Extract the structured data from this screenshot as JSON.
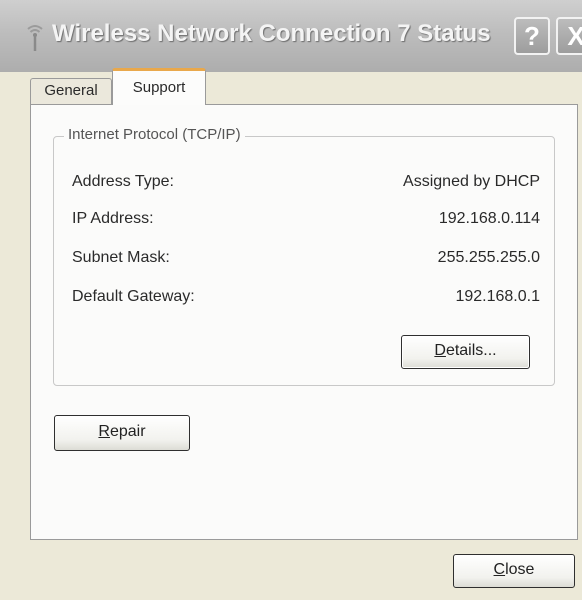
{
  "window": {
    "title": "Wireless Network Connection 7 Status",
    "help_label": "?",
    "close_label": "X"
  },
  "tabs": [
    {
      "label": "General",
      "selected": false
    },
    {
      "label": "Support",
      "selected": true
    }
  ],
  "group": {
    "legend": "Internet Protocol (TCP/IP)",
    "rows": [
      {
        "label": "Address Type:",
        "value": "Assigned by DHCP"
      },
      {
        "label": "IP Address:",
        "value": "192.168.0.114"
      },
      {
        "label": "Subnet Mask:",
        "value": "255.255.255.0"
      },
      {
        "label": "Default Gateway:",
        "value": "192.168.0.1"
      }
    ],
    "details_label": "Details..."
  },
  "repair_label": "Repair",
  "close_button_label": "Close",
  "colors": {
    "selected_tab_highlight": "#e9a84b",
    "dialog_background": "#ece9d8"
  },
  "icons": {
    "title": "wireless-network-icon"
  }
}
